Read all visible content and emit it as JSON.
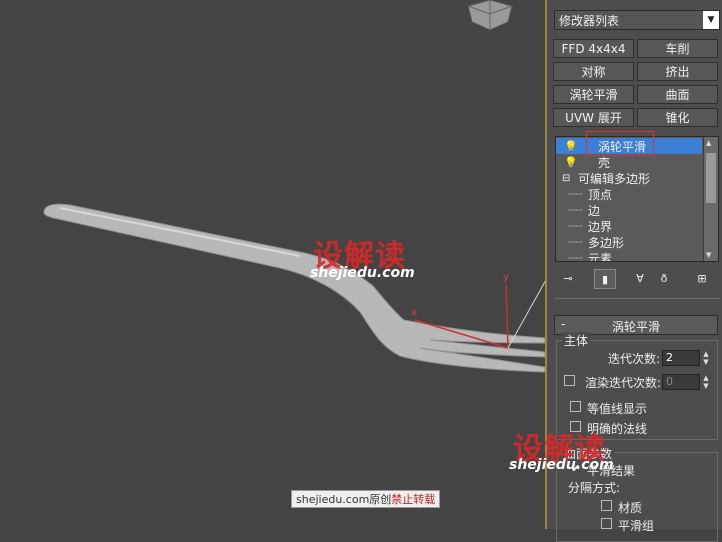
{
  "viewport": {
    "axis_x": "x",
    "axis_y": "y"
  },
  "panel": {
    "modifier_list": "修改器列表",
    "modifier_buttons": [
      "FFD 4x4x4",
      "车削",
      "对称",
      "挤出",
      "涡轮平滑",
      "曲面",
      "UVW 展开",
      "锥化"
    ],
    "stack": [
      {
        "label": "涡轮平滑",
        "selected": true
      },
      {
        "label": "壳",
        "selected": false
      },
      {
        "label": "可编辑多边形",
        "selected": false
      },
      {
        "label": "顶点",
        "selected": false
      },
      {
        "label": "边",
        "selected": false
      },
      {
        "label": "边界",
        "selected": false
      },
      {
        "label": "多边形",
        "selected": false
      },
      {
        "label": "元素",
        "selected": false
      }
    ],
    "toolbar_icons": [
      "pin-stack-icon",
      "show-end-result-icon",
      "make-unique-icon",
      "remove-modifier-icon",
      "configure-modifier-sets-icon"
    ]
  },
  "turbosmooth": {
    "rollout_minus": "-",
    "rollout_title": "涡轮平滑",
    "main_group": "主体",
    "iterations_label": "迭代次数:",
    "iterations_value": "2",
    "render_iters_label": "渲染迭代次数:",
    "render_iters_value": "0",
    "render_iters_checked": false,
    "isoline_label": "等值线显示",
    "isoline_checked": false,
    "explicit_normals_label": "明确的法线",
    "explicit_normals_checked": false,
    "surface_group": "曲面参数",
    "smooth_result_label": "平滑结果",
    "smooth_result_checked": true,
    "separate_by_label": "分隔方式:",
    "materials_label": "材质",
    "materials_checked": false,
    "smoothing_groups_label": "平滑组",
    "smoothing_groups_checked": false
  },
  "watermarks": {
    "brand_cn": "设解读",
    "brand_url": "shejiedu.com",
    "footer_site": "shejiedu.com",
    "footer_orig": "原创",
    "footer_forbid": "禁止转载"
  }
}
